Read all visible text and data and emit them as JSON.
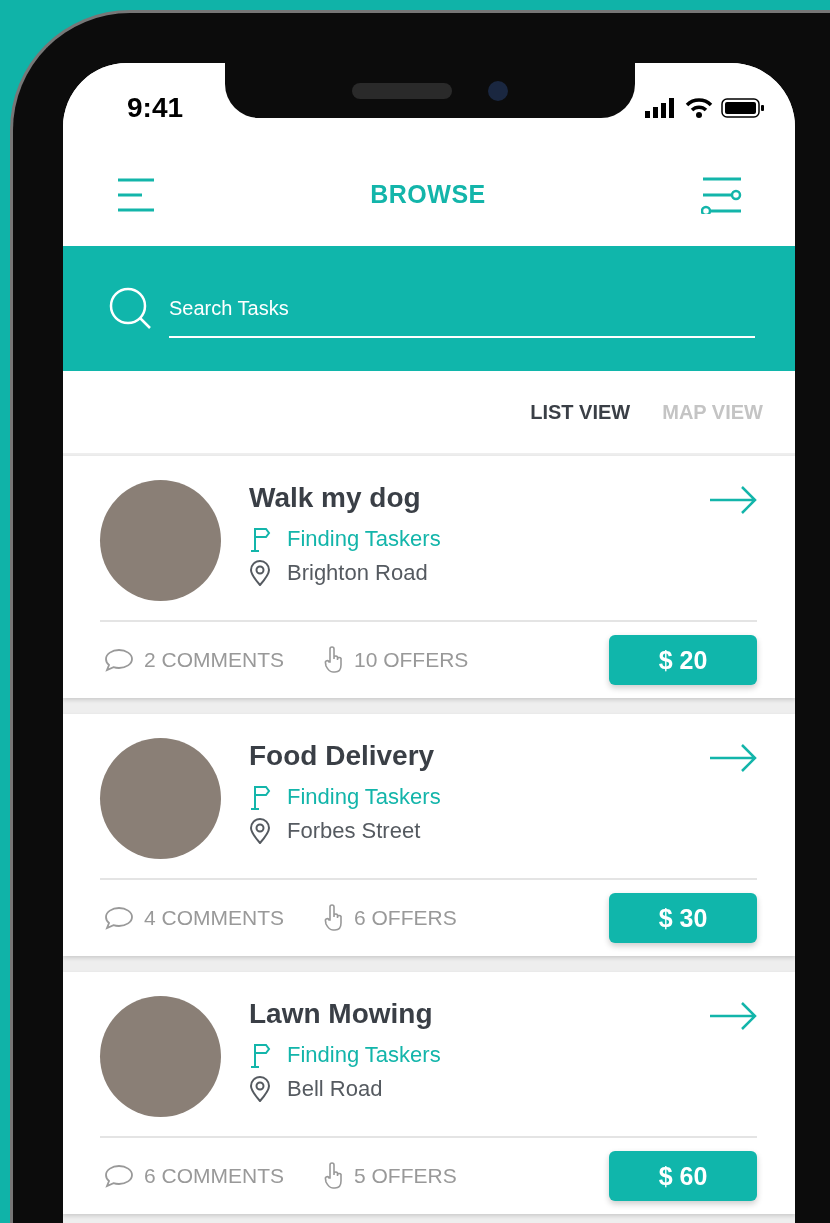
{
  "status_bar": {
    "time": "9:41"
  },
  "header": {
    "title": "BROWSE"
  },
  "search": {
    "placeholder": "Search Tasks"
  },
  "view_toggle": [
    {
      "label": "LIST VIEW",
      "selected": true
    },
    {
      "label": "MAP VIEW",
      "selected": false
    }
  ],
  "tasks": [
    {
      "title": "Walk my dog",
      "status": "Finding Taskers",
      "location": "Brighton Road",
      "comments": "2 COMMENTS",
      "offers": "10 OFFERS",
      "price": "$ 20"
    },
    {
      "title": "Food Delivery",
      "status": "Finding Taskers",
      "location": "Forbes Street",
      "comments": "4 COMMENTS",
      "offers": "6 OFFERS",
      "price": "$ 30"
    },
    {
      "title": "Lawn Mowing",
      "status": "Finding Taskers",
      "location": "Bell Road",
      "comments": "6 COMMENTS",
      "offers": "5 OFFERS",
      "price": "$ 60"
    }
  ]
}
